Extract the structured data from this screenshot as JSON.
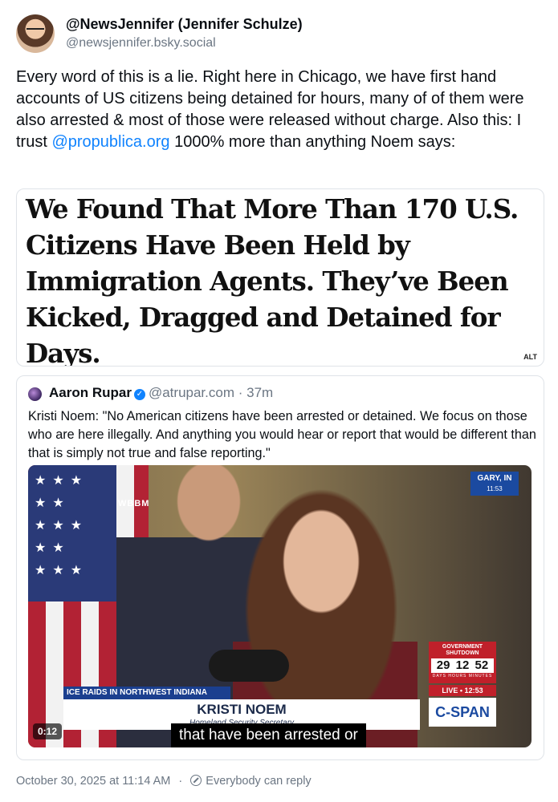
{
  "post": {
    "author": {
      "display_name": "@NewsJennifer (Jennifer Schulze)",
      "handle": "@newsjennifer.bsky.social"
    },
    "text_before_mention": "Every word of this is a lie.  Right here in Chicago, we have first hand accounts of US citizens being detained for hours, many of of them were also arrested & most of those were released without charge.  Also this:  I trust ",
    "mention": "@propublica.org",
    "text_after_mention": " 1000% more than anything Noem says:",
    "image": {
      "headline": "We Found That More Than 170 U.S. Citizens Have Been Held by Immigration Agents. They’ve Been Kicked, Dragged and Detained for Days.",
      "alt_badge": "ALT"
    },
    "quote": {
      "author_name": "Aaron Rupar",
      "handle": "@atrupar.com",
      "separator": "·",
      "time": "37m",
      "text": "Kristi Noem: \"No American citizens have been arrested or detained. We focus on those who are here illegally. And anything you would hear or report that would be different than that is simply not true and false reporting.\"",
      "video": {
        "station": "WBBM",
        "location": "GARY, IN",
        "location_time": "11:53",
        "shutdown_label": "GOVERNMENT SHUTDOWN",
        "shutdown_count": "29 12 52",
        "shutdown_units": "DAYS HOURS MINUTES",
        "live_label": "LIVE • 12:53",
        "network": "C-SPAN",
        "chyron_topic": "ICE RAIDS IN NORTHWEST INDIANA",
        "chyron_name": "KRISTI NOEM",
        "chyron_title": "Homeland Security Secretary",
        "caption": "that have been arrested or",
        "timestamp": "0:12",
        "flag_stars": "★★★ ★★ ★★★ ★★ ★★★"
      }
    },
    "footer": {
      "date": "October 30, 2025 at 11:14 AM",
      "reply_setting": "Everybody can reply"
    }
  }
}
